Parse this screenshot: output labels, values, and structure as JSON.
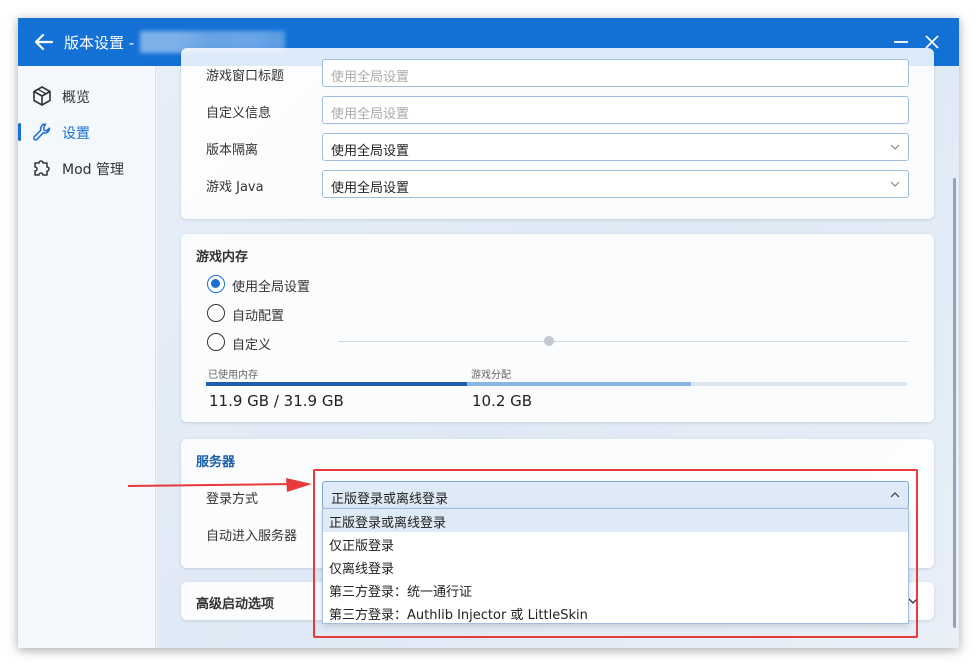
{
  "window": {
    "title": "版本设置 -",
    "minimize_icon": "minimize-icon",
    "close_icon": "close-icon"
  },
  "sidebar": {
    "items": [
      {
        "label": "概览",
        "icon": "cube-icon",
        "active": false
      },
      {
        "label": "设置",
        "icon": "wrench-icon",
        "active": true
      },
      {
        "label": "Mod 管理",
        "icon": "puzzle-icon",
        "active": false
      }
    ]
  },
  "game_settings": {
    "rows": [
      {
        "label": "游戏窗口标题",
        "placeholder": "使用全局设置",
        "type": "text"
      },
      {
        "label": "自定义信息",
        "placeholder": "使用全局设置",
        "type": "text"
      },
      {
        "label": "版本隔离",
        "value": "使用全局设置",
        "type": "select"
      },
      {
        "label": "游戏 Java",
        "value": "使用全局设置",
        "type": "select"
      }
    ]
  },
  "memory": {
    "title": "游戏内存",
    "options": [
      {
        "label": "使用全局设置",
        "checked": true
      },
      {
        "label": "自动配置",
        "checked": false
      },
      {
        "label": "自定义",
        "checked": false
      }
    ],
    "used_label": "已使用内存",
    "used_value": "11.9 GB / 31.9 GB",
    "alloc_label": "游戏分配",
    "alloc_value": "10.2 GB",
    "used_fraction": 0.373,
    "alloc_fraction": 0.32,
    "slider_fraction": 0.37
  },
  "server": {
    "title": "服务器",
    "login_label": "登录方式",
    "login_value": "正版登录或离线登录",
    "auto_join_label": "自动进入服务器",
    "dropdown_options": [
      "正版登录或离线登录",
      "仅正版登录",
      "仅离线登录",
      "第三方登录：统一通行证",
      "第三方登录：Authlib Injector 或 LittleSkin"
    ]
  },
  "advanced": {
    "title": "高级启动选项"
  },
  "colors": {
    "accent": "#1371d6",
    "highlight": "#e83a3a"
  }
}
